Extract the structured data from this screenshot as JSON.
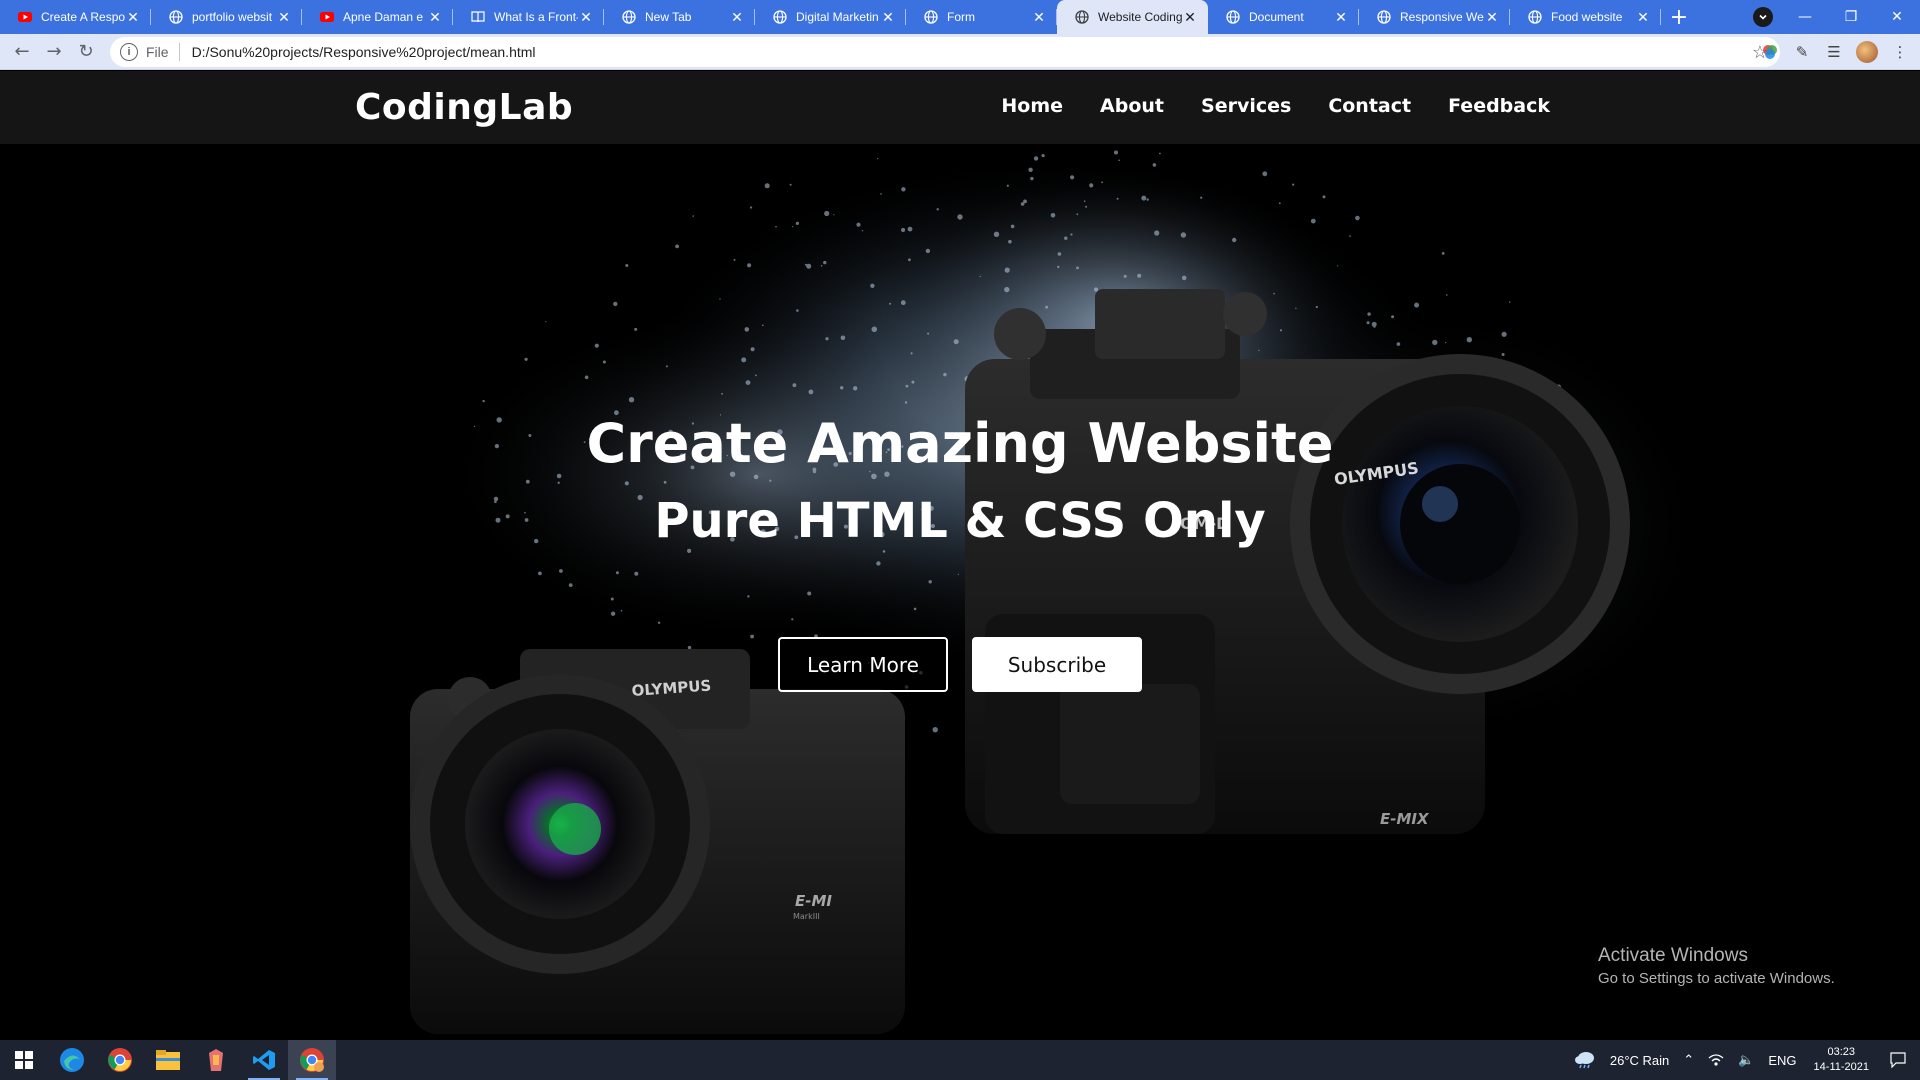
{
  "browser": {
    "tabs": [
      {
        "title": "Create A Respon",
        "favicon": "youtube-icon",
        "active": false
      },
      {
        "title": "portfolio websit",
        "favicon": "globe-icon",
        "active": false
      },
      {
        "title": "Apne Daman e",
        "favicon": "youtube-icon",
        "active": false
      },
      {
        "title": "What Is a Front-",
        "favicon": "book-icon",
        "active": false
      },
      {
        "title": "New Tab",
        "favicon": "globe-icon",
        "active": false
      },
      {
        "title": "Digital Marketin",
        "favicon": "globe-icon",
        "active": false
      },
      {
        "title": "Form",
        "favicon": "globe-icon",
        "active": false
      },
      {
        "title": "Website Coding",
        "favicon": "globe-icon",
        "active": true
      },
      {
        "title": "Document",
        "favicon": "globe-icon",
        "active": false
      },
      {
        "title": "Responsive Web",
        "favicon": "globe-icon",
        "active": false
      },
      {
        "title": "Food website",
        "favicon": "globe-icon",
        "active": false
      }
    ],
    "address": {
      "scheme_label": "File",
      "url": "D:/Sonu%20projects/Responsive%20project/mean.html"
    }
  },
  "site": {
    "logo": "CodingLab",
    "nav": [
      "Home",
      "About",
      "Services",
      "Contact",
      "Feedback"
    ],
    "hero": {
      "title": "Create Amazing Website",
      "subtitle": "Pure HTML & CSS Only",
      "learn_more": "Learn More",
      "subscribe": "Subscribe"
    },
    "camera_labels": {
      "brand_left": "OLYMPUS",
      "brand_right": "OLYMPUS",
      "model_omd": "OM-D",
      "model_emi": "E-MI",
      "model_mark": "MarkIII",
      "model_emix": "E-MIX"
    }
  },
  "watermark": {
    "line1": "Activate Windows",
    "line2": "Go to Settings to activate Windows."
  },
  "taskbar": {
    "weather": "26°C  Rain",
    "language": "ENG",
    "time": "03:23",
    "date": "14-11-2021"
  },
  "colors": {
    "tab_strip": "#3c72e0",
    "toolbar": "#dee6f7",
    "nav_bg": "#151515",
    "taskbar": "#1d2331"
  }
}
